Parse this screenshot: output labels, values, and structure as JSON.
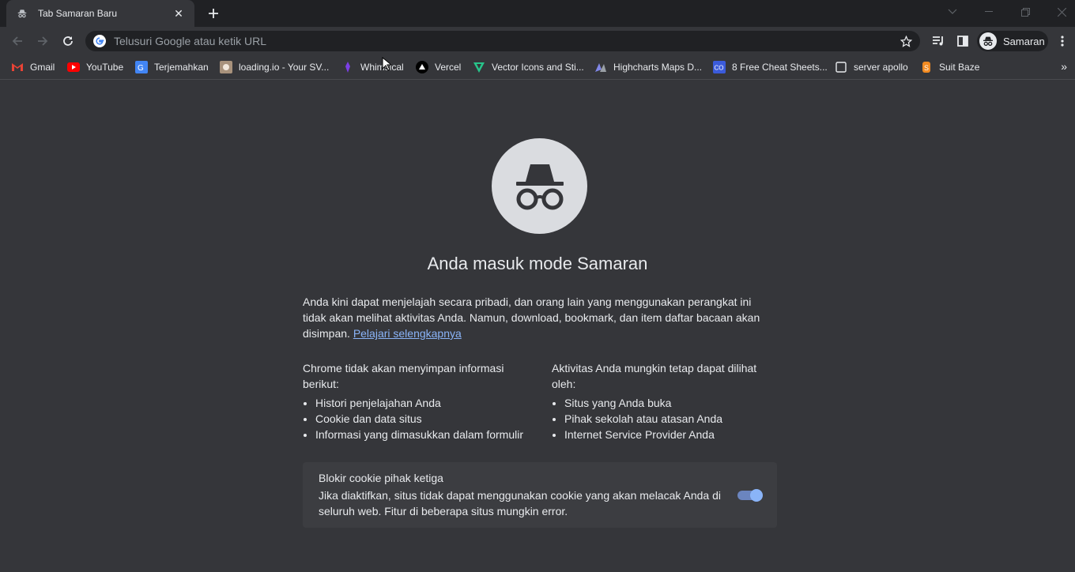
{
  "tab": {
    "title": "Tab Samaran Baru"
  },
  "omnibox": {
    "placeholder": "Telusuri Google atau ketik URL"
  },
  "profile": {
    "label": "Samaran"
  },
  "bookmarks": [
    {
      "label": "Gmail",
      "icon": "gmail-icon"
    },
    {
      "label": "YouTube",
      "icon": "youtube-icon"
    },
    {
      "label": "Terjemahkan",
      "icon": "translate-icon"
    },
    {
      "label": "loading.io - Your SV...",
      "icon": "loadingio-icon"
    },
    {
      "label": "Whimsical",
      "icon": "whimsical-icon"
    },
    {
      "label": "Vercel",
      "icon": "vercel-icon"
    },
    {
      "label": "Vector Icons and Sti...",
      "icon": "vector-icons-icon"
    },
    {
      "label": "Highcharts Maps D...",
      "icon": "highcharts-icon"
    },
    {
      "label": "8 Free Cheat Sheets...",
      "icon": "cheatsheet-icon"
    },
    {
      "label": "server apollo",
      "icon": "page-icon"
    },
    {
      "label": "Suit Baze",
      "icon": "suitbaze-icon"
    }
  ],
  "page": {
    "heading": "Anda masuk mode Samaran",
    "intro": "Anda kini dapat menjelajah secara pribadi, dan orang lain yang menggunakan perangkat ini tidak akan melihat aktivitas Anda. Namun, download, bookmark, dan item daftar bacaan akan disimpan.",
    "learn_more": "Pelajari selengkapnya",
    "left_col": {
      "title": "Chrome tidak akan menyimpan informasi berikut:",
      "items": [
        "Histori penjelajahan Anda",
        "Cookie dan data situs",
        "Informasi yang dimasukkan dalam formulir"
      ]
    },
    "right_col": {
      "title": "Aktivitas Anda mungkin tetap dapat dilihat oleh:",
      "items": [
        "Situs yang Anda buka",
        "Pihak sekolah atau atasan Anda",
        "Internet Service Provider Anda"
      ]
    },
    "cookie": {
      "title": "Blokir cookie pihak ketiga",
      "desc": "Jika diaktifkan, situs tidak dapat menggunakan cookie yang akan melacak Anda di seluruh web. Fitur di beberapa situs mungkin error.",
      "enabled": true
    }
  },
  "colors": {
    "background": "#35363a",
    "tabstrip": "#202124",
    "accent": "#8ab4f8"
  }
}
